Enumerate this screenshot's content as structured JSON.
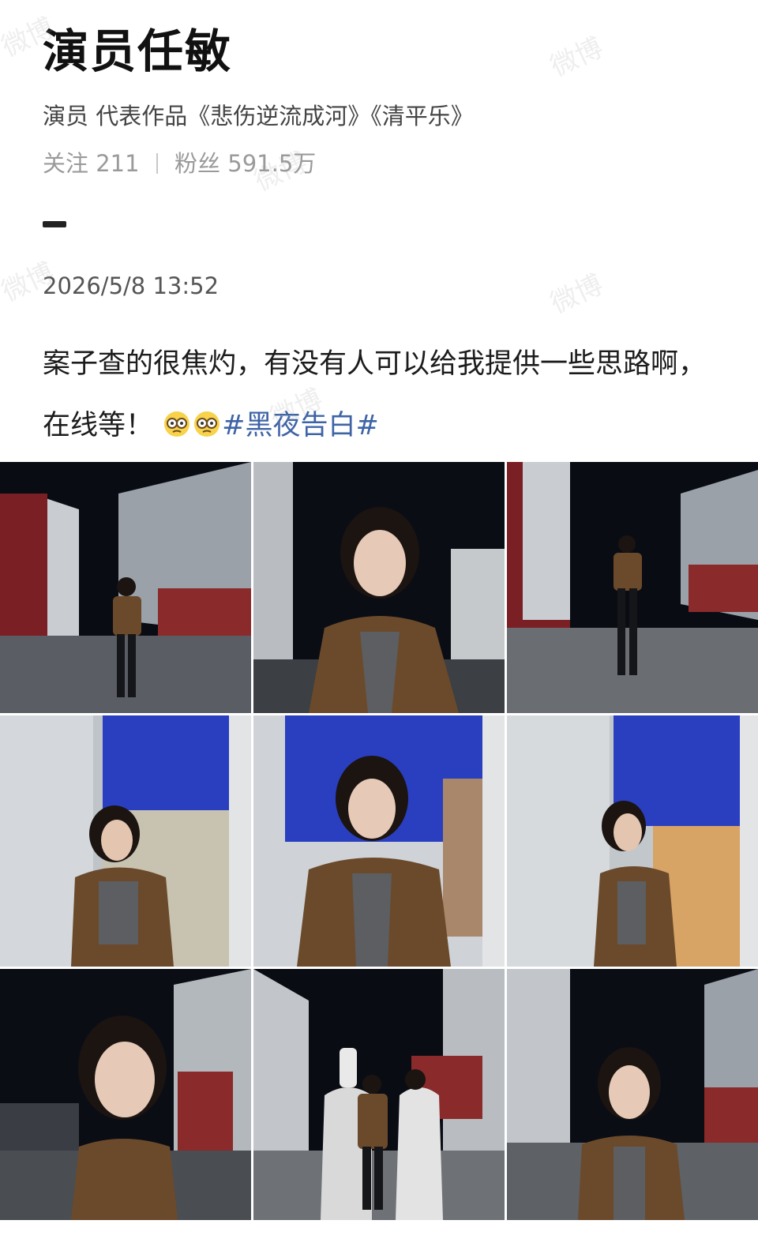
{
  "profile": {
    "name": "演员任敏",
    "description": "演员 代表作品《悲伤逆流成河》《清平乐》",
    "following_label": "关注",
    "following_count": "211",
    "followers_label": "粉丝",
    "followers_count": "591.5万"
  },
  "post": {
    "timestamp": "2026/5/8 13:52",
    "text": "案子查的很焦灼，有没有人可以给我提供一些思路啊，在线等！",
    "emojis": [
      "confused-glasses-emoji",
      "confused-glasses-emoji"
    ],
    "hashtag": "#黑夜告白#"
  },
  "photos": [
    {
      "scene": "night-warehouse-trucks-full-body"
    },
    {
      "scene": "night-trucks-closeup"
    },
    {
      "scene": "night-warehouse-standing"
    },
    {
      "scene": "blue-tarp-truck-door-arms-crossed"
    },
    {
      "scene": "blue-tarp-truck-door-closeup"
    },
    {
      "scene": "blue-tarp-truck-door-side"
    },
    {
      "scene": "night-trucks-portrait"
    },
    {
      "scene": "night-trucks-group-costumes"
    },
    {
      "scene": "night-trucks-half-body"
    }
  ],
  "watermark": "微博",
  "colors": {
    "hashtag": "#3e64a6",
    "meta_gray": "#9a9a9a",
    "night_sky": "#0a0c14",
    "tarp_blue": "#2a3fbf",
    "jacket_brown": "#6b4a2b"
  }
}
